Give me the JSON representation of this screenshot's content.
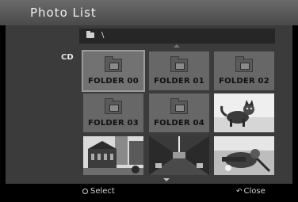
{
  "window": {
    "title": "Photo List"
  },
  "source": {
    "label": "CD"
  },
  "path": {
    "text": "\\"
  },
  "folders": [
    {
      "label": "FOLDER 00",
      "selected": true
    },
    {
      "label": "FOLDER 01",
      "selected": false
    },
    {
      "label": "FOLDER 02",
      "selected": false
    },
    {
      "label": "FOLDER 03",
      "selected": false
    },
    {
      "label": "FOLDER 04",
      "selected": false
    }
  ],
  "photos": [
    {
      "subject": "cat"
    },
    {
      "subject": "building"
    },
    {
      "subject": "tunnel"
    },
    {
      "subject": "sports"
    }
  ],
  "footer": {
    "select_label": "Select",
    "close_label": "Close"
  }
}
